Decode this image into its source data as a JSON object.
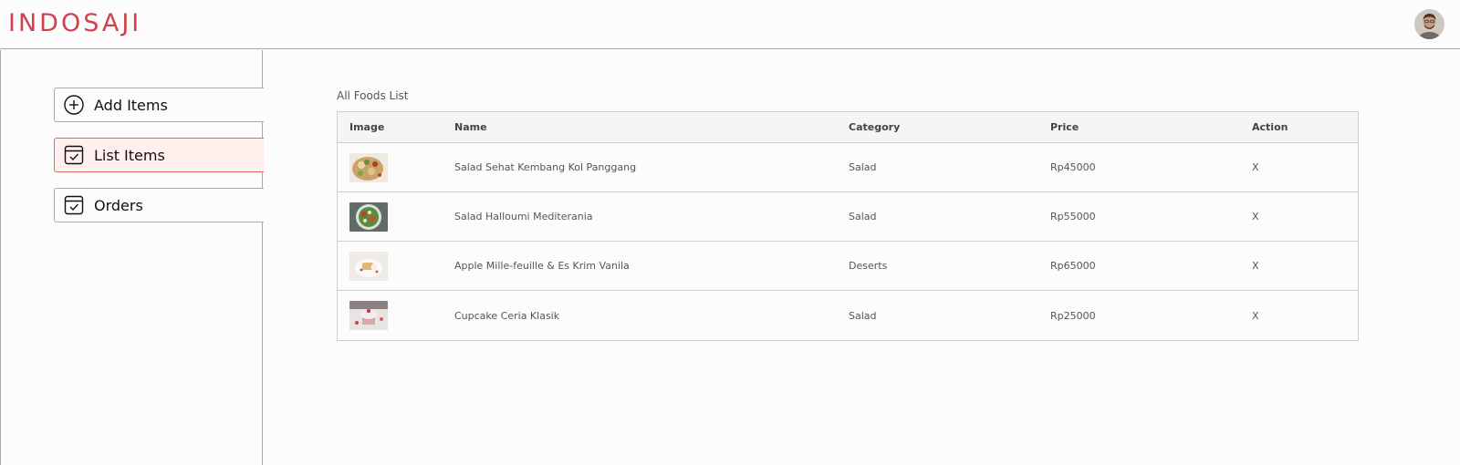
{
  "header": {
    "logo": "INDOSAJI",
    "avatar": "profile-avatar"
  },
  "sidebar": {
    "items": [
      {
        "label": "Add Items",
        "icon": "add-circle-icon",
        "active": false
      },
      {
        "label": "List Items",
        "icon": "checklist-icon",
        "active": true
      },
      {
        "label": "Orders",
        "icon": "checklist-icon",
        "active": false
      }
    ]
  },
  "main": {
    "title": "All Foods List",
    "columns": [
      "Image",
      "Name",
      "Category",
      "Price",
      "Action"
    ],
    "rows": [
      {
        "name": "Salad Sehat Kembang Kol Panggang",
        "category": "Salad",
        "price": "Rp45000",
        "action": "X",
        "image": "salad-cauliflower-thumb"
      },
      {
        "name": "Salad Halloumi Mediterania",
        "category": "Salad",
        "price": "Rp55000",
        "action": "X",
        "image": "salad-halloumi-thumb"
      },
      {
        "name": "Apple Mille-feuille & Es Krim Vanila",
        "category": "Deserts",
        "price": "Rp65000",
        "action": "X",
        "image": "apple-millefeuille-thumb"
      },
      {
        "name": "Cupcake Ceria Klasik",
        "category": "Salad",
        "price": "Rp25000",
        "action": "X",
        "image": "cupcake-thumb"
      }
    ]
  },
  "colors": {
    "brand": "#d23f4e",
    "active_bg": "#fff0ee",
    "active_border": "#e06a6a"
  }
}
